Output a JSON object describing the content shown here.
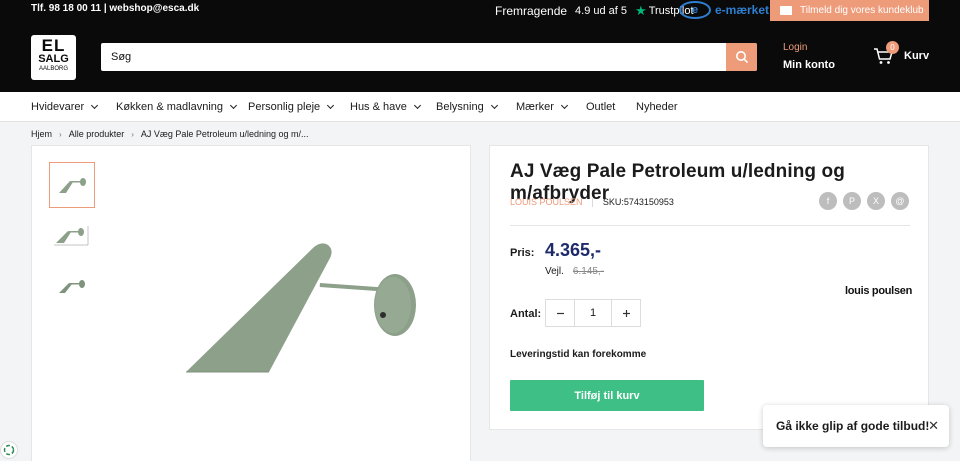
{
  "topbar": {
    "contact": "Tlf. 98 18 00 11 | webshop@esca.dk",
    "rating_word": "Fremragende",
    "rating_score": "4.9 ud af 5",
    "trustpilot": "Trustpilot",
    "emark": "e-mærket",
    "club": "Tilmeld dig vores kundeklub"
  },
  "logo": {
    "line1": "EL",
    "line2": "SALG",
    "line3": "AALBORG"
  },
  "search": {
    "placeholder": "Søg"
  },
  "account": {
    "login": "Login",
    "my_account": "Min konto"
  },
  "cart": {
    "count": "0",
    "label": "Kurv"
  },
  "nav": {
    "items": [
      {
        "label": "Hvidevarer"
      },
      {
        "label": "Køkken & madlavning"
      },
      {
        "label": "Personlig pleje"
      },
      {
        "label": "Hus & have"
      },
      {
        "label": "Belysning"
      },
      {
        "label": "Mærker"
      },
      {
        "label": "Outlet"
      },
      {
        "label": "Nyheder"
      }
    ]
  },
  "breadcrumb": [
    "Hjem",
    "Alle produkter",
    "AJ Væg Pale Petroleum u/ledning og m/..."
  ],
  "product": {
    "title": "AJ Væg Pale Petroleum u/ledning og m/afbryder",
    "vendor": "LOUIS POULSEN",
    "sku": "SKU:5743150953",
    "price_label": "Pris:",
    "price": "4.365,-",
    "rrp_label": "Vejl.",
    "rrp": "6.145,-",
    "brand_logo": "louis poulsen",
    "qty_label": "Antal:",
    "qty": "1",
    "delivery": "Leveringstid kan forekomme",
    "add_to_cart": "Tilføj til kurv",
    "share": [
      "f",
      "P",
      "X",
      "@"
    ]
  },
  "popup": {
    "text": "Gå ikke glip af gode tilbud!",
    "close": "✕"
  },
  "colors": {
    "accent": "#ee9b7a",
    "cta": "#3dbf86",
    "price": "#1e2b6b",
    "lamp": "#8da08a"
  }
}
